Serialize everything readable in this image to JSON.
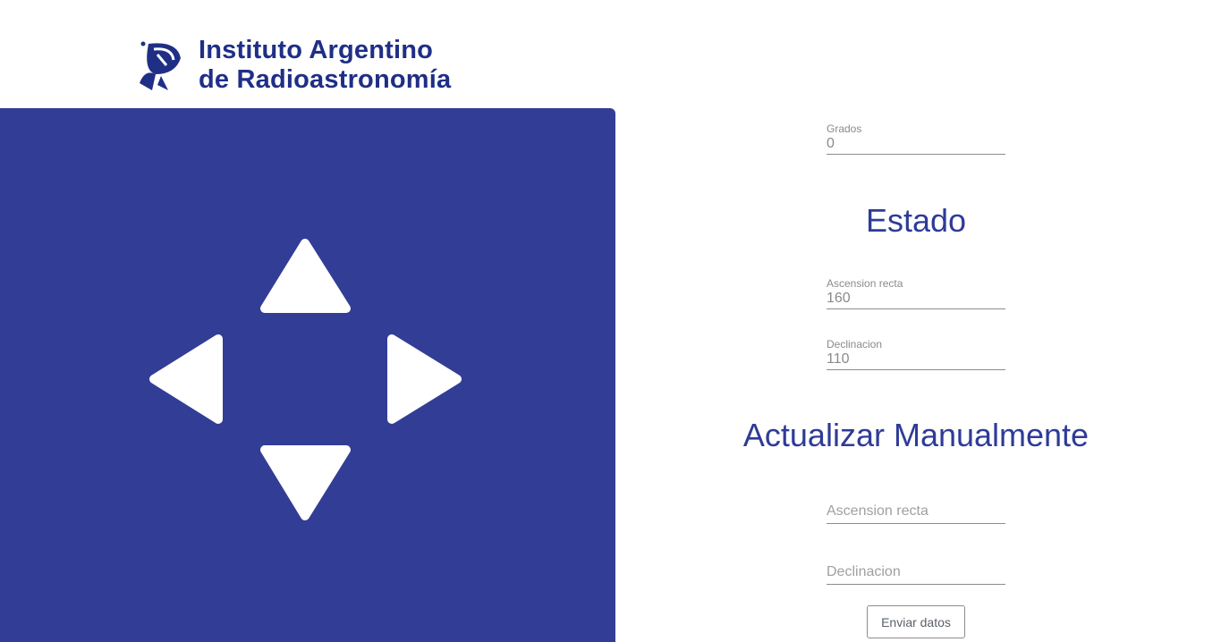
{
  "brand": {
    "line1": "Instituto Argentino",
    "line2": "de Radioastronomía",
    "color": "#1f2f86"
  },
  "control_pad": {
    "background": "#323d96",
    "arrows": [
      "arrow-up-icon",
      "arrow-left-icon",
      "arrow-right-icon",
      "arrow-down-icon"
    ]
  },
  "degrees": {
    "label": "Grados",
    "value": "0"
  },
  "status": {
    "title": "Estado",
    "ra": {
      "label": "Ascension recta",
      "value": "160"
    },
    "dec": {
      "label": "Declinacion",
      "value": "110"
    }
  },
  "manual": {
    "title": "Actualizar Manualmente",
    "ra_placeholder": "Ascension recta",
    "dec_placeholder": "Declinacion",
    "submit_label": "Enviar datos"
  }
}
